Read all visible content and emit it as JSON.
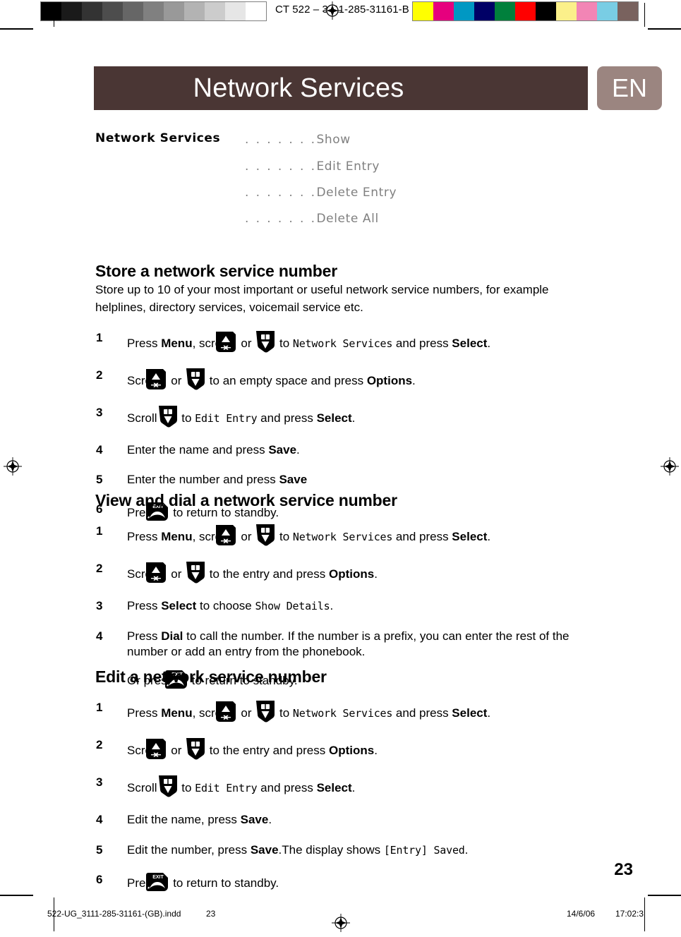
{
  "prepress": {
    "plate_code": "CT 522  –   3111-285-31161-B",
    "gray_swatches": [
      "#000000",
      "#1a1a1a",
      "#333333",
      "#4d4d4d",
      "#666666",
      "#808080",
      "#999999",
      "#b3b3b3",
      "#cccccc",
      "#e6e6e6",
      "#ffffff"
    ],
    "color_swatches": [
      "#ffff00",
      "#e6007e",
      "#0098c3",
      "#000066",
      "#00803c",
      "#ff0000",
      "#000000",
      "#fbf08a",
      "#f285b5",
      "#79cde4",
      "#79625e"
    ],
    "registration_mark": "registration-target-icon"
  },
  "header": {
    "title": "Network Services",
    "language_badge": "EN",
    "band_color": "#4a3634",
    "badge_color": "#9b8580"
  },
  "menu_tree": {
    "root": "Network Services",
    "dots": ". . . . . . .",
    "leaves": [
      "Show",
      "Edit Entry",
      "Delete Entry",
      "Delete All"
    ]
  },
  "sections": [
    {
      "id": "store",
      "heading": "Store a network service number",
      "intro": "Store up to 10 of your most important or useful network service numbers, for example helplines, directory services, voicemail service etc.",
      "steps": [
        {
          "num": "1",
          "parts": [
            {
              "t": "text",
              "v": "Press "
            },
            {
              "t": "bold",
              "v": "Menu"
            },
            {
              "t": "text",
              "v": ", scroll"
            },
            {
              "t": "key",
              "v": "key-up"
            },
            {
              "t": "text",
              "v": " or "
            },
            {
              "t": "key",
              "v": "key-down"
            },
            {
              "t": "text",
              "v": " to "
            },
            {
              "t": "mono",
              "v": "Network Services"
            },
            {
              "t": "text",
              "v": "  and press "
            },
            {
              "t": "bold",
              "v": "Select"
            },
            {
              "t": "text",
              "v": "."
            }
          ]
        },
        {
          "num": "2",
          "parts": [
            {
              "t": "text",
              "v": "Scroll"
            },
            {
              "t": "key",
              "v": "key-up"
            },
            {
              "t": "text",
              "v": " or "
            },
            {
              "t": "key",
              "v": "key-down"
            },
            {
              "t": "text",
              "v": " to an empty space and press "
            },
            {
              "t": "bold",
              "v": "Options"
            },
            {
              "t": "text",
              "v": "."
            }
          ]
        },
        {
          "num": "3",
          "parts": [
            {
              "t": "text",
              "v": "Scroll"
            },
            {
              "t": "key",
              "v": "key-down"
            },
            {
              "t": "text",
              "v": " to "
            },
            {
              "t": "mono",
              "v": "Edit Entry"
            },
            {
              "t": "text",
              "v": "  and press "
            },
            {
              "t": "bold",
              "v": "Select"
            },
            {
              "t": "text",
              "v": "."
            }
          ]
        },
        {
          "num": "4",
          "parts": [
            {
              "t": "text",
              "v": "Enter the name and press "
            },
            {
              "t": "bold",
              "v": "Save"
            },
            {
              "t": "text",
              "v": "."
            }
          ]
        },
        {
          "num": "5",
          "parts": [
            {
              "t": "text",
              "v": "Enter the number and press "
            },
            {
              "t": "bold",
              "v": "Save"
            }
          ]
        },
        {
          "num": "6",
          "parts": [
            {
              "t": "text",
              "v": "Press"
            },
            {
              "t": "key",
              "v": "key-exit"
            },
            {
              "t": "text",
              "v": " to return to standby."
            }
          ]
        }
      ]
    },
    {
      "id": "view",
      "heading": "View and dial a network service number",
      "intro": "",
      "steps": [
        {
          "num": "1",
          "parts": [
            {
              "t": "text",
              "v": "Press "
            },
            {
              "t": "bold",
              "v": "Menu"
            },
            {
              "t": "text",
              "v": ", scroll"
            },
            {
              "t": "key",
              "v": "key-up"
            },
            {
              "t": "text",
              "v": " or "
            },
            {
              "t": "key",
              "v": "key-down"
            },
            {
              "t": "text",
              "v": " to "
            },
            {
              "t": "mono",
              "v": "Network Services"
            },
            {
              "t": "text",
              "v": "  and press "
            },
            {
              "t": "bold",
              "v": "Select"
            },
            {
              "t": "text",
              "v": "."
            }
          ]
        },
        {
          "num": "2",
          "parts": [
            {
              "t": "text",
              "v": "Scroll"
            },
            {
              "t": "key",
              "v": "key-up"
            },
            {
              "t": "text",
              "v": " or "
            },
            {
              "t": "key",
              "v": "key-down"
            },
            {
              "t": "text",
              "v": " to the entry and press "
            },
            {
              "t": "bold",
              "v": "Options"
            },
            {
              "t": "text",
              "v": "."
            }
          ]
        },
        {
          "num": "3",
          "parts": [
            {
              "t": "text",
              "v": "Press "
            },
            {
              "t": "bold",
              "v": "Select"
            },
            {
              "t": "text",
              "v": " to choose "
            },
            {
              "t": "mono",
              "v": "Show Details"
            },
            {
              "t": "text",
              "v": "."
            }
          ]
        },
        {
          "num": "4",
          "wrap": true,
          "parts": [
            {
              "t": "text",
              "v": "Press "
            },
            {
              "t": "bold",
              "v": "Dial"
            },
            {
              "t": "text",
              "v": " to call the number. If the number is a prefix, you can enter the rest of the number or add an entry from the phonebook."
            }
          ]
        }
      ],
      "tail": [
        {
          "t": "text",
          "v": "Or press "
        },
        {
          "t": "key",
          "v": "key-exit"
        },
        {
          "t": "text",
          "v": " to return to standby."
        }
      ]
    },
    {
      "id": "edit",
      "heading": "Edit a network service number",
      "intro": "",
      "steps": [
        {
          "num": "1",
          "parts": [
            {
              "t": "text",
              "v": "Press "
            },
            {
              "t": "bold",
              "v": "Menu"
            },
            {
              "t": "text",
              "v": ", scroll"
            },
            {
              "t": "key",
              "v": "key-up"
            },
            {
              "t": "text",
              "v": " or "
            },
            {
              "t": "key",
              "v": "key-down"
            },
            {
              "t": "text",
              "v": " to "
            },
            {
              "t": "mono",
              "v": "Network Services"
            },
            {
              "t": "text",
              "v": "  and press "
            },
            {
              "t": "bold",
              "v": "Select"
            },
            {
              "t": "text",
              "v": "."
            }
          ]
        },
        {
          "num": "2",
          "parts": [
            {
              "t": "text",
              "v": "Scroll"
            },
            {
              "t": "key",
              "v": "key-up"
            },
            {
              "t": "text",
              "v": " or "
            },
            {
              "t": "key",
              "v": "key-down"
            },
            {
              "t": "text",
              "v": " to the entry and press "
            },
            {
              "t": "bold",
              "v": "Options"
            },
            {
              "t": "text",
              "v": "."
            }
          ]
        },
        {
          "num": "3",
          "parts": [
            {
              "t": "text",
              "v": "Scroll"
            },
            {
              "t": "key",
              "v": "key-down"
            },
            {
              "t": "text",
              "v": " to "
            },
            {
              "t": "mono",
              "v": "Edit Entry"
            },
            {
              "t": "text",
              "v": "  and press "
            },
            {
              "t": "bold",
              "v": "Select"
            },
            {
              "t": "text",
              "v": "."
            }
          ]
        },
        {
          "num": "4",
          "parts": [
            {
              "t": "text",
              "v": "Edit the name, press "
            },
            {
              "t": "bold",
              "v": "Save"
            },
            {
              "t": "text",
              "v": "."
            }
          ]
        },
        {
          "num": "5",
          "parts": [
            {
              "t": "text",
              "v": "Edit the number, press "
            },
            {
              "t": "bold",
              "v": "Save"
            },
            {
              "t": "text",
              "v": ".The display shows "
            },
            {
              "t": "mono",
              "v": "[Entry] Saved"
            },
            {
              "t": "text",
              "v": "."
            }
          ]
        },
        {
          "num": "6",
          "parts": [
            {
              "t": "text",
              "v": "Press"
            },
            {
              "t": "key",
              "v": "key-exit"
            },
            {
              "t": "text",
              "v": " to return to standby."
            }
          ]
        }
      ]
    }
  ],
  "page_number": "23",
  "footer": {
    "file_name": "522-UG_3111-285-31161-(GB).indd",
    "page": "23",
    "date": "14/6/06",
    "time": "17:02:3"
  }
}
